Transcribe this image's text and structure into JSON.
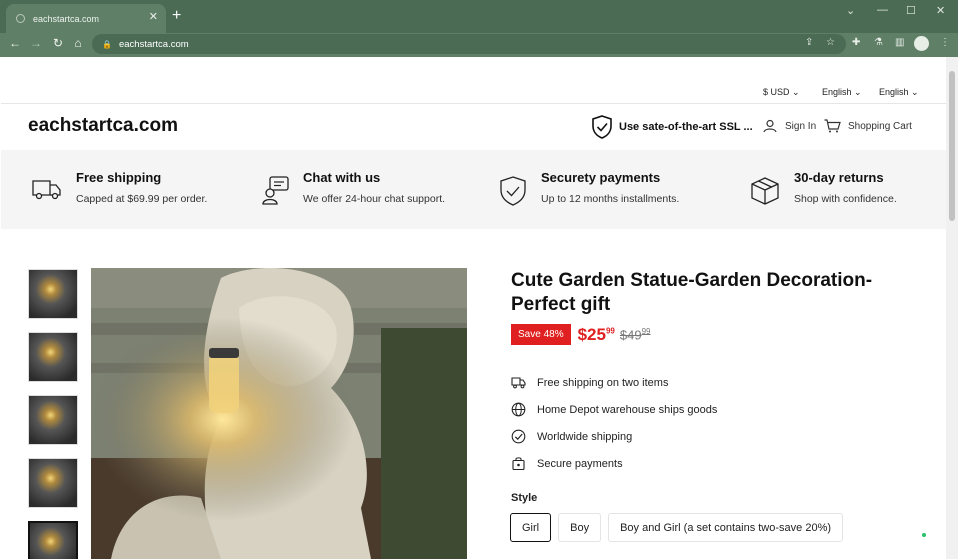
{
  "browser": {
    "tab_title": "eachstartca.com",
    "url": "eachstartca.com"
  },
  "util": {
    "currency": "$ USD",
    "language1": "English",
    "language2": "English"
  },
  "header": {
    "site_title": "eachstartca.com",
    "ssl_text": "Use sate-of-the-art SSL ...",
    "signin": "Sign In",
    "cart": "Shopping Cart"
  },
  "features": [
    {
      "title": "Free shipping",
      "sub": "Capped at $69.99 per order."
    },
    {
      "title": "Chat with us",
      "sub": "We offer 24-hour chat support."
    },
    {
      "title": "Securety payments",
      "sub": "Up to 12 months installments."
    },
    {
      "title": "30-day returns",
      "sub": "Shop with confidence."
    }
  ],
  "product": {
    "title": "Cute Garden Statue-Garden Decoration-Perfect gift",
    "save": "Save 48%",
    "price_main": "$25",
    "price_cents": "99",
    "was_main": "$49",
    "was_cents": "99",
    "perks": [
      "Free shipping on two items",
      "Home Depot warehouse ships goods",
      "Worldwide shipping",
      "Secure payments"
    ],
    "style_label": "Style",
    "options": [
      "Girl",
      "Boy",
      "Boy and Girl (a set contains two-save 20%)"
    ],
    "selected_option": "Girl"
  },
  "colors": {
    "chrome": "#4b6b54",
    "accent": "#e02020"
  }
}
